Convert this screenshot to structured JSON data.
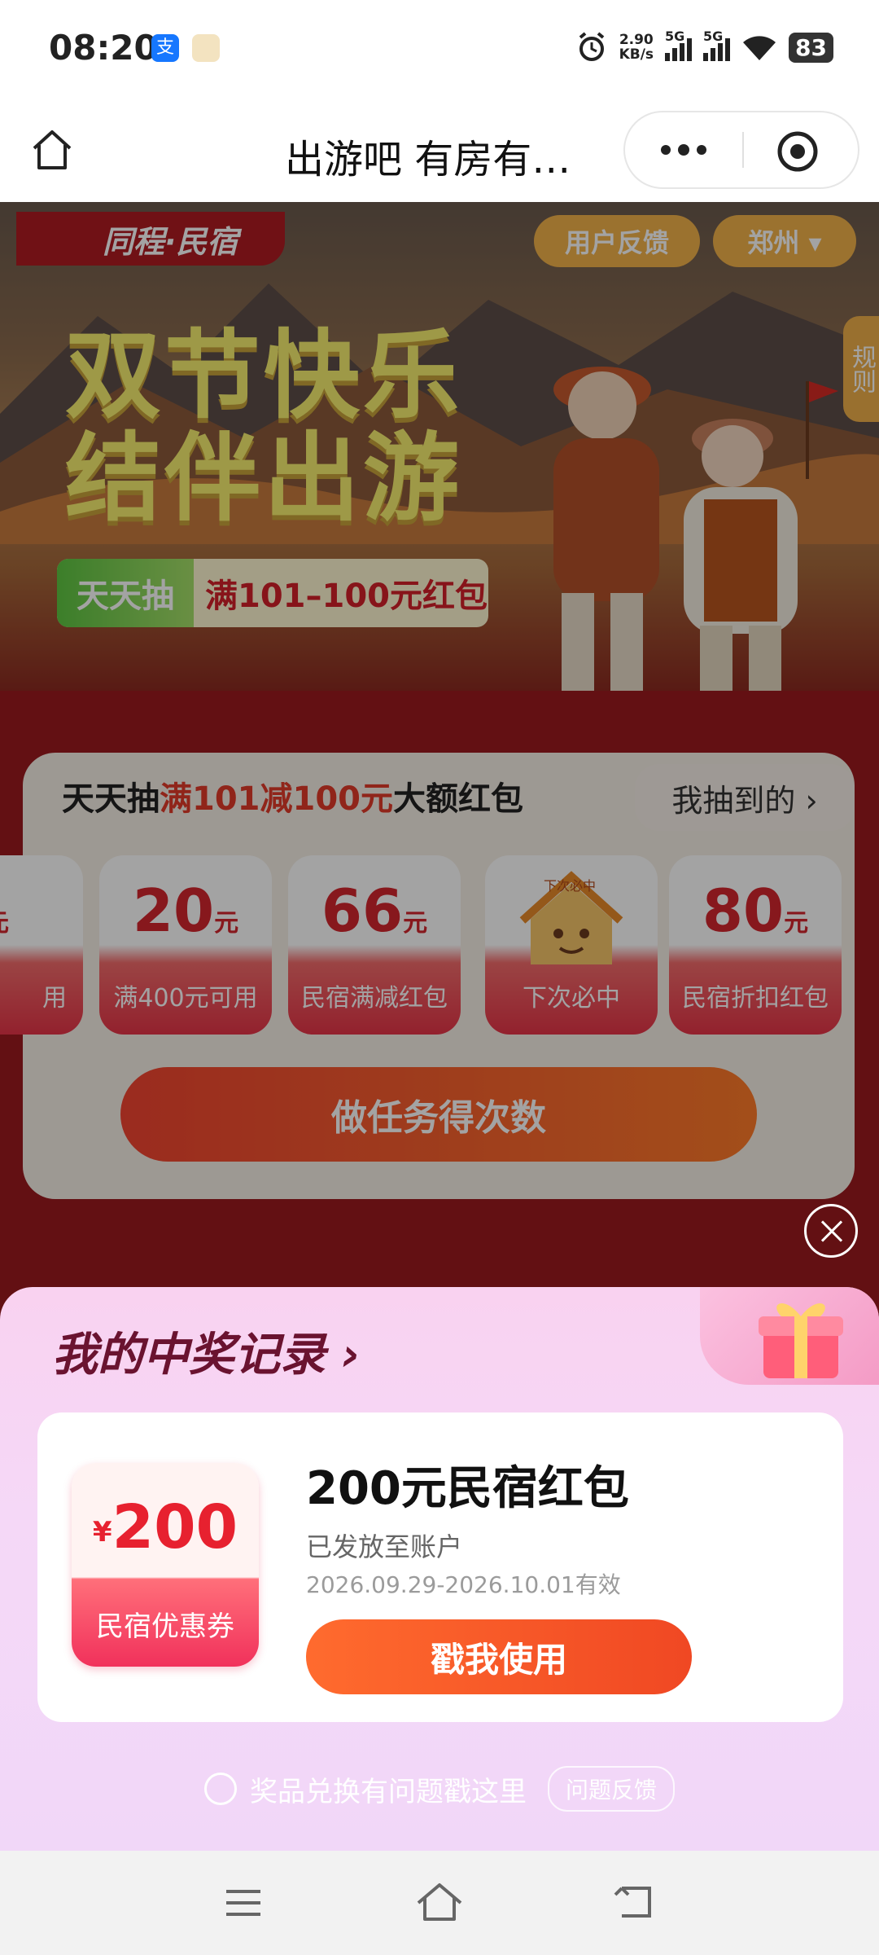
{
  "status_bar": {
    "time": "08:20",
    "net_speed_value": "2.90",
    "net_speed_unit": "KB/s",
    "signal_1_label": "5G",
    "signal_2_label": "5G",
    "battery": "83"
  },
  "titlebar": {
    "title": "出游吧 有房有…"
  },
  "page": {
    "brand": "同程·民宿",
    "feedback_label": "用户反馈",
    "city_label": "郑州 ▾",
    "rules_label": "规则",
    "headline_line1": "双节快乐",
    "headline_line2": "结伴出游",
    "strip_left": "天天抽",
    "strip_right": "满101–100元红包",
    "draw": {
      "title_prefix": "天天抽",
      "title_highlight": "满101减100元",
      "title_suffix": "大额红包",
      "mine_label": "我抽到的 ›",
      "prizes": [
        {
          "amount": "",
          "unit": "元",
          "label": "用"
        },
        {
          "amount": "20",
          "unit": "元",
          "label": "满400元可用"
        },
        {
          "amount": "66",
          "unit": "元",
          "label": "民宿满减红包"
        },
        {
          "amount": "",
          "unit": "",
          "label": "下次必中",
          "badge": "下次必中"
        },
        {
          "amount": "80",
          "unit": "元",
          "label": "民宿折扣红包"
        }
      ],
      "task_button": "做任务得次数"
    }
  },
  "sheet": {
    "title": "我的中奖记录 ›",
    "record": {
      "coupon_currency": "¥",
      "coupon_value": "200",
      "coupon_caption": "民宿优惠券",
      "name": "200元民宿红包",
      "status": "已发放至账户",
      "validity": "2026.09.29-2026.10.01有效",
      "use_button": "戳我使用"
    },
    "help_text": "奖品兑换有问题戳这里",
    "help_button": "问题反馈"
  },
  "colors": {
    "accent_orange": "#ff6b2e",
    "coupon_red": "#e7212f",
    "sheet_pink": "#f9d2f0",
    "page_red": "#9b1a1f"
  }
}
